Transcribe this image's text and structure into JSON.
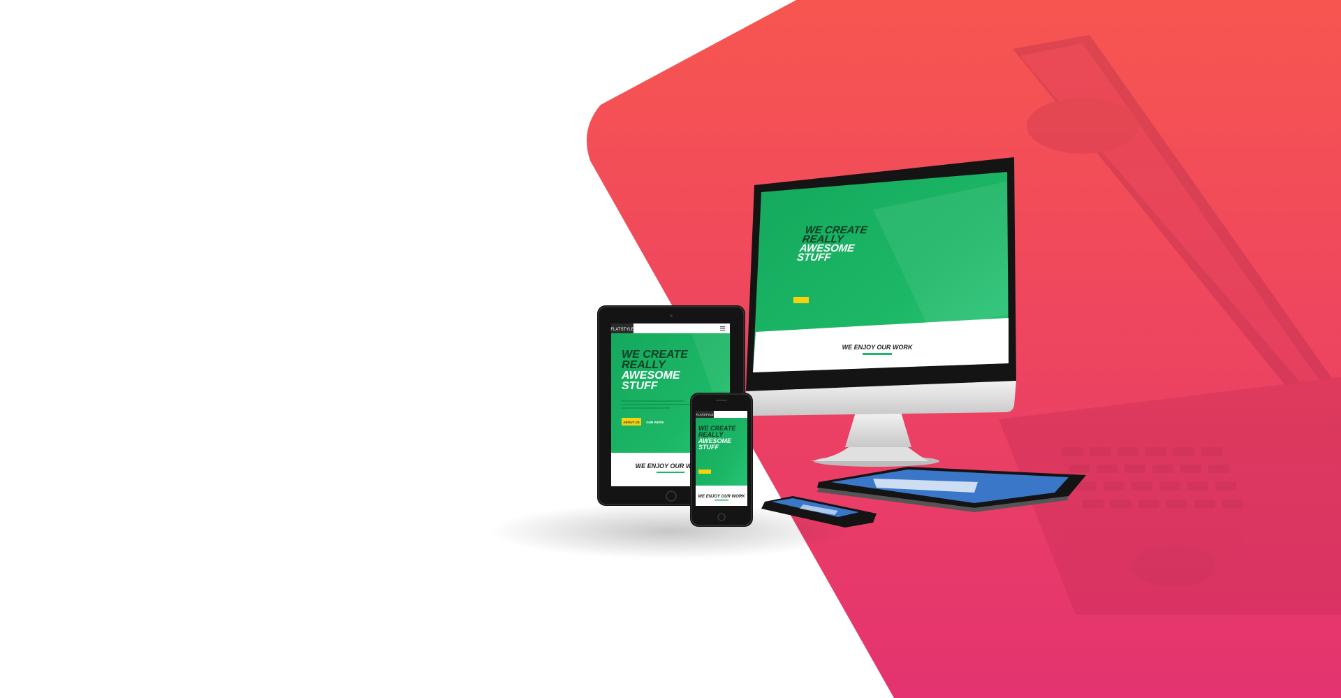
{
  "colors": {
    "gradient_top": "#f75650",
    "gradient_bottom": "#e43370",
    "screen_green": "#1cb766",
    "screen_green_dark": "#12a35a",
    "button_yellow": "#f6d20e",
    "device_black": "#141414",
    "stand_silver": "#d9d9d9"
  },
  "mockup": {
    "brand": "FLATSTYLE",
    "headline_line1": "WE CREATE",
    "headline_line2": "REALLY",
    "headline_line3": "AWESOME",
    "headline_line4": "STUFF",
    "primary_button": "ABOUT US",
    "secondary_button": "OUR WORK",
    "section_title": "WE ENJOY OUR WORK"
  },
  "icons": {
    "menu": "hamburger-menu-icon",
    "home": "home-button-icon"
  }
}
